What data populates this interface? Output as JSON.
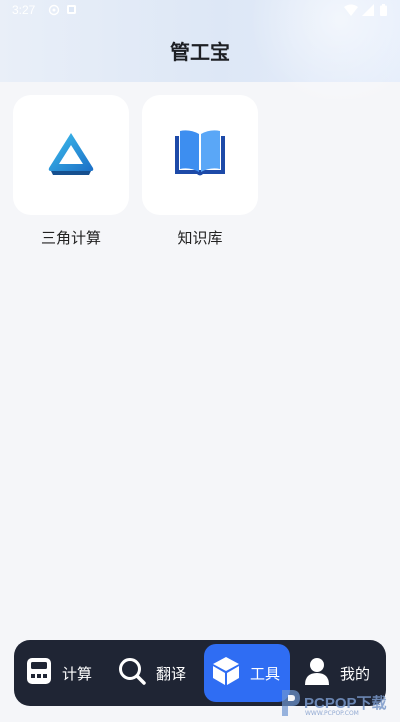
{
  "status_bar": {
    "time": "3:27"
  },
  "header": {
    "title": "管工宝"
  },
  "tools": [
    {
      "label": "三角计算",
      "icon": "triangle-icon"
    },
    {
      "label": "知识库",
      "icon": "book-icon"
    }
  ],
  "nav": {
    "items": [
      {
        "label": "计算",
        "icon": "calculator-icon"
      },
      {
        "label": "翻译",
        "icon": "search-icon"
      },
      {
        "label": "工具",
        "icon": "cube-icon"
      },
      {
        "label": "我的",
        "icon": "user-icon"
      }
    ],
    "active_index": 2,
    "active_color": "#2f6df3",
    "bar_color": "#1f2534"
  },
  "watermark": {
    "brand": "PCPOP下载",
    "sub": "WWW.PCPOP.COM"
  }
}
